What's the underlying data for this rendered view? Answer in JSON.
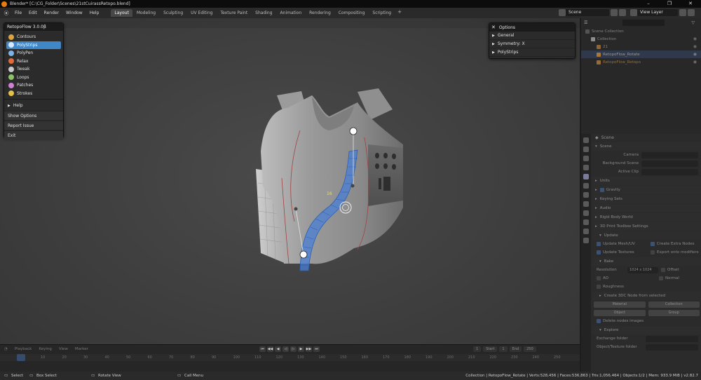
{
  "titlebar": {
    "title": "Blender* [C:\\CG_Folder\\Scenes\\21stCuirassRetopo.blend]",
    "controls": [
      "–",
      "❐",
      "✕"
    ]
  },
  "menubar": {
    "items": [
      "File",
      "Edit",
      "Render",
      "Window",
      "Help"
    ]
  },
  "workspaces": {
    "tabs": [
      "Layout",
      "Modeling",
      "Sculpting",
      "UV Editing",
      "Texture Paint",
      "Shading",
      "Animation",
      "Rendering",
      "Compositing",
      "Scripting"
    ],
    "active": "Layout",
    "add": "+"
  },
  "scene_selector": {
    "scene": "Scene",
    "view_layer": "View Layer"
  },
  "retopoflow": {
    "title": "RetopoFlow 3.0.0β",
    "tools": [
      {
        "label": "Contours",
        "color": "#d9a441"
      },
      {
        "label": "PolyStrips",
        "color": "#4e8fd6",
        "selected": true
      },
      {
        "label": "PolyPen",
        "color": "#7fb4e2"
      },
      {
        "label": "Relax",
        "color": "#e06a3a"
      },
      {
        "label": "Tweak",
        "color": "#c9c9c9"
      },
      {
        "label": "Loops",
        "color": "#8cc46a"
      },
      {
        "label": "Patches",
        "color": "#d27fd6"
      },
      {
        "label": "Strokes",
        "color": "#e0c24a"
      }
    ],
    "help": "Help",
    "show_options": "Show Options",
    "report_issue": "Report Issue",
    "exit": "Exit"
  },
  "options": {
    "title": "Options",
    "sections": [
      "General",
      "Symmetry: X",
      "PolyStrips"
    ]
  },
  "viewport": {
    "strip_count": "16"
  },
  "outliner": {
    "rows": [
      {
        "label": "Scene Collection"
      },
      {
        "label": "Collection"
      },
      {
        "label": "21"
      },
      {
        "label": "RetopoFlow_Rotate"
      },
      {
        "label": "RetopoFlow_Retopo"
      }
    ]
  },
  "properties": {
    "header": "Scene",
    "scene_section": "Scene",
    "camera_label": "Camera",
    "background_scene_label": "Background Scene",
    "active_clip_label": "Active Clip",
    "sections": [
      "Units",
      "Gravity",
      "Keying Sets",
      "Audio",
      "Rigid Body World",
      "3D Print Toolbox Settings"
    ],
    "update_label": "Update",
    "update_mesh_uv": "Update Mesh/UV",
    "create_extra_nodes": "Create Extra Nodes",
    "update_textures": "Update Textures",
    "export_into_modifiers": "Export onto modifiers",
    "bake_label": "Bake",
    "resolution_label": "Resolution",
    "resolution_value": "1024 x 1024",
    "offset": "Offset",
    "ao": "AO",
    "normal": "Normal",
    "roughness": "Roughness",
    "create_3dc_label": "Create 3DC Node from selected",
    "material": "Material",
    "collection": "Collection",
    "object": "Object",
    "group": "Group",
    "delete_nodes": "Delete nodes images",
    "explore": "Explore",
    "exchange_folder": "Exchange folder",
    "object_texture_folder": "Object/Texture folder"
  },
  "timeline": {
    "menus": [
      "Playback",
      "Keying",
      "View",
      "Marker"
    ],
    "controls": [
      "⏮",
      "◀◀",
      "◀",
      "◁",
      "▷",
      "▶",
      "▶▶",
      "⏭"
    ],
    "start_label": "Start",
    "start_value": "1",
    "end_label": "End",
    "end_value": "250",
    "current_frame": "1",
    "ruler": [
      "10",
      "20",
      "30",
      "40",
      "50",
      "60",
      "70",
      "80",
      "90",
      "100",
      "110",
      "120",
      "130",
      "140",
      "150",
      "160",
      "170",
      "180",
      "190",
      "200",
      "210",
      "220",
      "230",
      "240",
      "250"
    ]
  },
  "statusbar": {
    "select": "Select",
    "box_select": "Box Select",
    "rotate_view": "Rotate View",
    "call_menu": "Call Menu",
    "stats": "Collection | RetopoFlow_Rotate | Verts:528,456 | Faces:536,863 | Tris:1,056,464 | Objects:1/2 | Mem: 933.9 MiB | v2.82.7"
  }
}
